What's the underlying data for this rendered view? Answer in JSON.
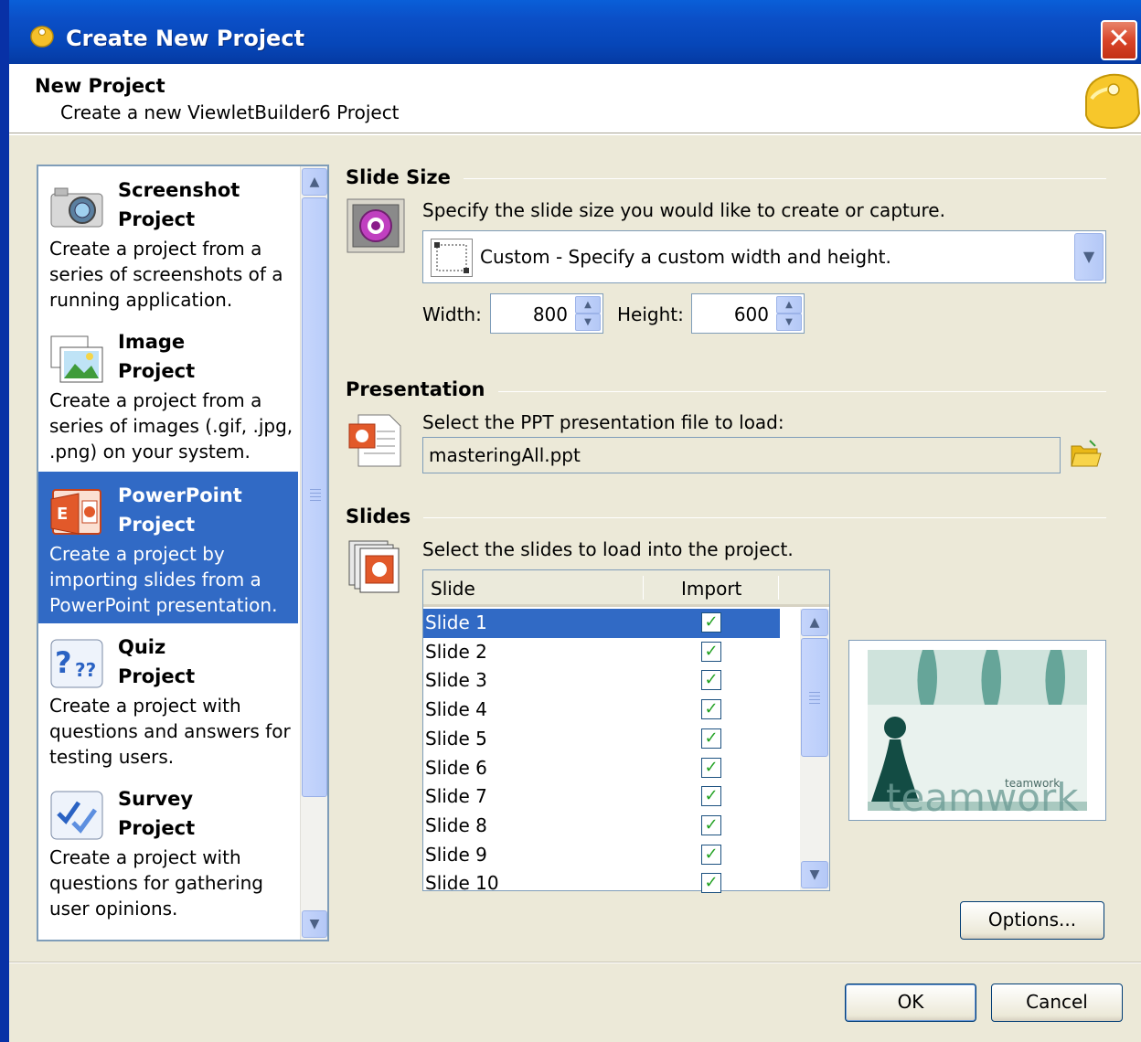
{
  "window": {
    "title": "Create New Project",
    "close_glyph": "✕"
  },
  "header": {
    "title": "New Project",
    "subtitle": "Create a new ViewletBuilder6 Project"
  },
  "project_types": [
    {
      "title_line1": "Screenshot",
      "title_line2": "Project",
      "desc": "Create a project from a series of screenshots of a running application.",
      "icon": "camera-icon",
      "selected": false
    },
    {
      "title_line1": "Image",
      "title_line2": "Project",
      "desc": "Create a project from a series of images (.gif, .jpg, .png) on your system.",
      "icon": "image-icon",
      "selected": false
    },
    {
      "title_line1": "PowerPoint",
      "title_line2": "Project",
      "desc": "Create a project by importing slides from a PowerPoint presentation.",
      "icon": "powerpoint-icon",
      "selected": true
    },
    {
      "title_line1": "Quiz",
      "title_line2": "Project",
      "desc": "Create a project with questions and answers for testing users.",
      "icon": "quiz-icon",
      "selected": false
    },
    {
      "title_line1": "Survey",
      "title_line2": "Project",
      "desc": "Create a project with questions for gathering user opinions.",
      "icon": "survey-icon",
      "selected": false
    }
  ],
  "slide_size": {
    "label": "Slide Size",
    "instruction": "Specify the slide size you would like to create or capture.",
    "dropdown_value": "Custom - Specify a custom width and height.",
    "width_label": "Width:",
    "width_value": "800",
    "height_label": "Height:",
    "height_value": "600"
  },
  "presentation": {
    "label": "Presentation",
    "instruction": "Select the PPT presentation file to load:",
    "file_value": "masteringAll.ppt"
  },
  "slides": {
    "label": "Slides",
    "instruction": "Select the slides to load into the project.",
    "columns": [
      "Slide",
      "Import"
    ],
    "rows": [
      {
        "name": "Slide 1",
        "import": true
      },
      {
        "name": "Slide 2",
        "import": true
      },
      {
        "name": "Slide 3",
        "import": true
      },
      {
        "name": "Slide 4",
        "import": true
      },
      {
        "name": "Slide 5",
        "import": true
      },
      {
        "name": "Slide 6",
        "import": true
      },
      {
        "name": "Slide 7",
        "import": true
      },
      {
        "name": "Slide 8",
        "import": true
      },
      {
        "name": "Slide 9",
        "import": true
      },
      {
        "name": "Slide 10",
        "import": true
      }
    ],
    "selected_index": 0,
    "preview_text_small": "teamwork",
    "preview_text_large": "teamwork"
  },
  "buttons": {
    "options": "Options...",
    "ok": "OK",
    "cancel": "Cancel"
  },
  "glyphs": {
    "up": "▲",
    "down": "▼",
    "check": "✓"
  },
  "colors": {
    "title_bar": "#0a5fd8",
    "selection": "#316ac5",
    "dialog_bg": "#ece9d8",
    "close_red": "#d9452a"
  }
}
